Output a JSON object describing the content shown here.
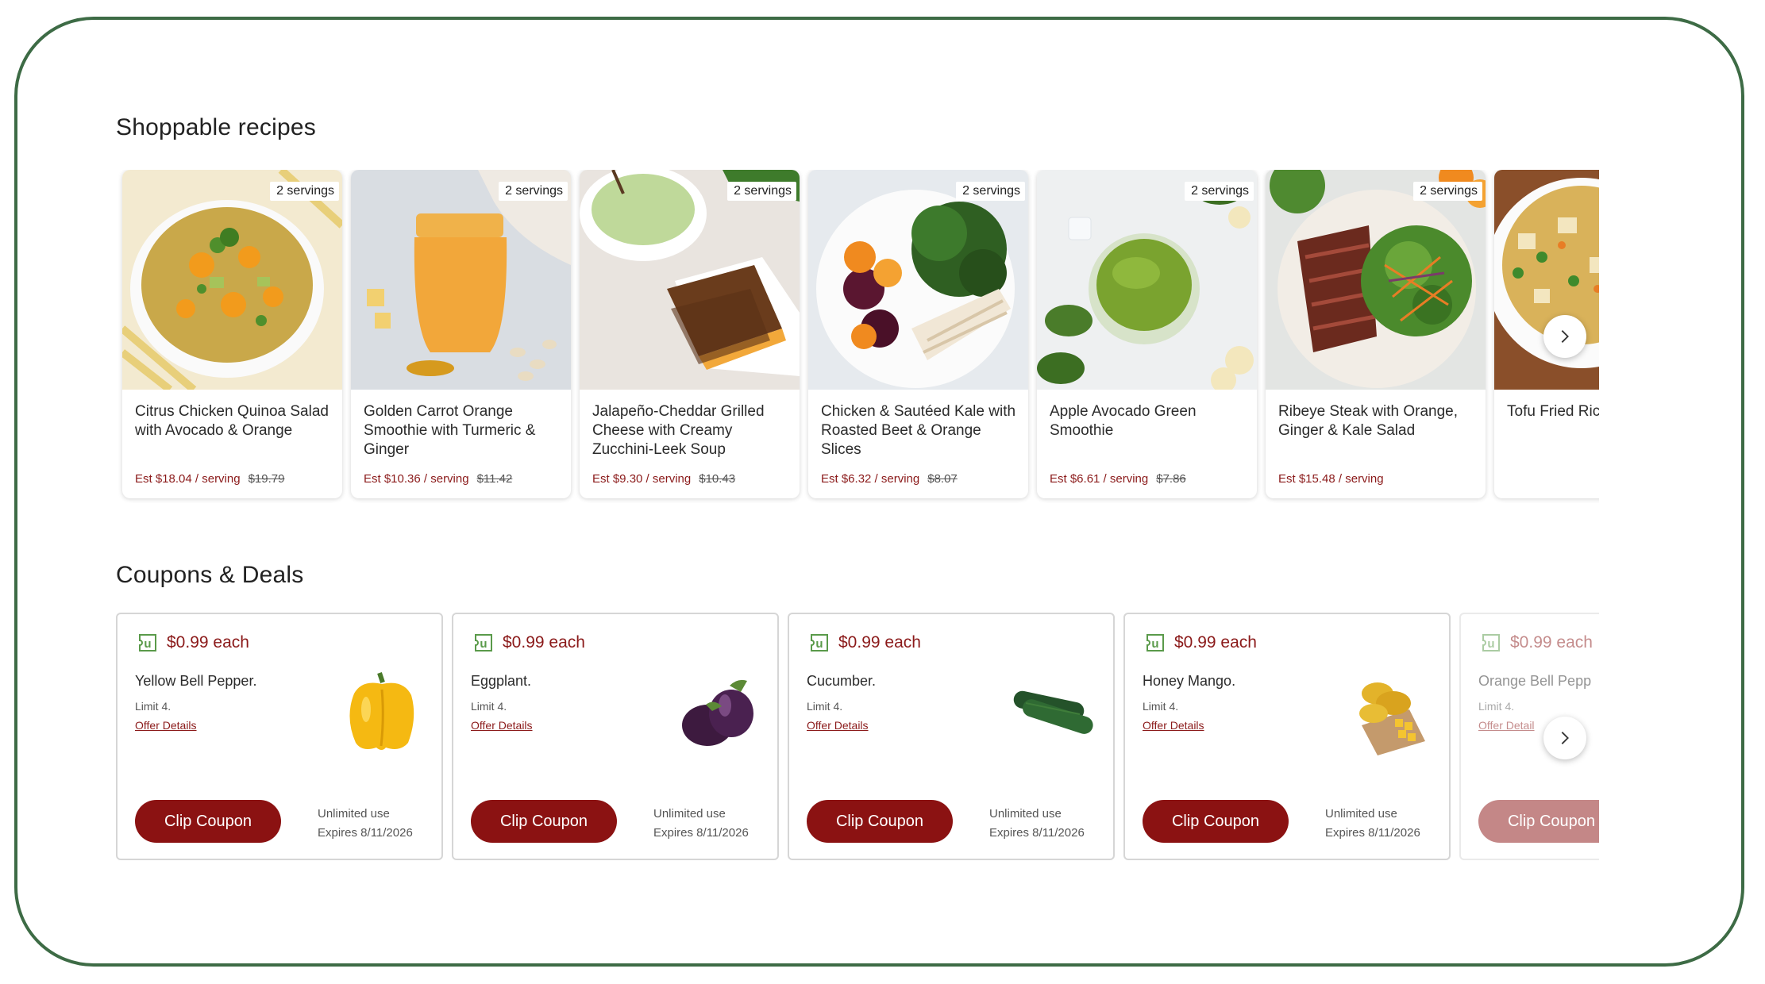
{
  "recipes": {
    "title": "Shoppable recipes",
    "items": [
      {
        "name": "Citrus Chicken Quinoa Salad with Avocado & Orange",
        "servings": "2 servings",
        "price": "Est $18.04 / serving",
        "was": "$19.79",
        "image": "quinoa-salad-bowl"
      },
      {
        "name": "Golden Carrot Orange Smoothie with Turmeric & Ginger",
        "servings": "2 servings",
        "price": "Est $10.36 / serving",
        "was": "$11.42",
        "image": "orange-smoothie-jar"
      },
      {
        "name": "Jalapeño-Cheddar Grilled Cheese with Creamy Zucchini-Leek Soup",
        "servings": "2 servings",
        "price": "Est $9.30 / serving",
        "was": "$10.43",
        "image": "grilled-cheese-soup"
      },
      {
        "name": "Chicken & Sautéed Kale with Roasted Beet & Orange Slices",
        "servings": "2 servings",
        "price": "Est $6.32 / serving",
        "was": "$8.07",
        "image": "chicken-kale-plate"
      },
      {
        "name": "Apple Avocado Green Smoothie",
        "servings": "2 servings",
        "price": "Est $6.61 / serving",
        "was": "$7.86",
        "image": "green-smoothie"
      },
      {
        "name": "Ribeye Steak with Orange, Ginger & Kale Salad",
        "servings": "2 servings",
        "price": "Est $15.48 / serving",
        "was": "",
        "image": "steak-salad"
      },
      {
        "name": "Tofu Fried Rice & Peas",
        "servings": "",
        "price": "",
        "was": "",
        "image": "fried-rice"
      }
    ],
    "next_icon": "chevron-right-icon"
  },
  "coupons": {
    "title": "Coupons & Deals",
    "items": [
      {
        "price": "$0.99 each",
        "item": "Yellow Bell Pepper.",
        "limit": "Limit 4.",
        "details": "Offer Details",
        "button": "Clip Coupon",
        "use": "Unlimited use",
        "expires": "Expires 8/11/2026",
        "image": "yellow-bell-pepper"
      },
      {
        "price": "$0.99 each",
        "item": "Eggplant.",
        "limit": "Limit 4.",
        "details": "Offer Details",
        "button": "Clip Coupon",
        "use": "Unlimited use",
        "expires": "Expires 8/11/2026",
        "image": "eggplant"
      },
      {
        "price": "$0.99 each",
        "item": "Cucumber.",
        "limit": "Limit 4.",
        "details": "Offer Details",
        "button": "Clip Coupon",
        "use": "Unlimited use",
        "expires": "Expires 8/11/2026",
        "image": "cucumber"
      },
      {
        "price": "$0.99 each",
        "item": "Honey Mango.",
        "limit": "Limit 4.",
        "details": "Offer Details",
        "button": "Clip Coupon",
        "use": "Unlimited use",
        "expires": "Expires 8/11/2026",
        "image": "honey-mango"
      },
      {
        "price": "$0.99 each",
        "item": "Orange Bell Pepp",
        "limit": "Limit 4.",
        "details": "Offer Detail",
        "button": "Clip Coupon",
        "use": "",
        "expires": "",
        "image": "orange-bell-pepper"
      }
    ],
    "coupon_icon": "u-coupon-icon",
    "next_icon": "chevron-right-icon"
  },
  "colors": {
    "brand_red": "#8b1212",
    "frame_green": "#3d6b45"
  }
}
